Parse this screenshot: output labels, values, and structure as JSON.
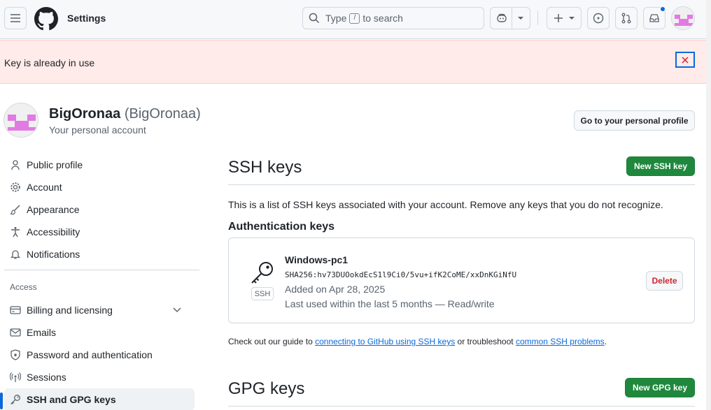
{
  "header": {
    "title": "Settings",
    "search": {
      "prefix": "Type",
      "key": "/",
      "suffix": "to search"
    }
  },
  "flash": {
    "message": "Key is already in use"
  },
  "profile": {
    "name": "BigOronaa",
    "handle": "(BigOronaa)",
    "subtitle": "Your personal account",
    "go_profile_label": "Go to your personal profile"
  },
  "sidebar": {
    "items": [
      {
        "label": "Public profile",
        "icon": "person-icon"
      },
      {
        "label": "Account",
        "icon": "gear-icon"
      },
      {
        "label": "Appearance",
        "icon": "paintbrush-icon"
      },
      {
        "label": "Accessibility",
        "icon": "accessibility-icon"
      },
      {
        "label": "Notifications",
        "icon": "bell-icon"
      }
    ],
    "access_heading": "Access",
    "access_items": [
      {
        "label": "Billing and licensing",
        "icon": "credit-card-icon"
      },
      {
        "label": "Emails",
        "icon": "mail-icon"
      },
      {
        "label": "Password and authentication",
        "icon": "shield-lock-icon"
      },
      {
        "label": "Sessions",
        "icon": "broadcast-icon"
      },
      {
        "label": "SSH and GPG keys",
        "icon": "key-icon",
        "active": true
      }
    ]
  },
  "ssh": {
    "title": "SSH keys",
    "new_label": "New SSH key",
    "description": "This is a list of SSH keys associated with your account. Remove any keys that you do not recognize.",
    "auth_heading": "Authentication keys",
    "key": {
      "name": "Windows-pc1",
      "fingerprint": "SHA256:hv73DUOokdEcS1l9Ci0/5vu+ifK2CoME/xxDnKGiNfU",
      "added": "Added on Apr 28, 2025",
      "last_used": "Last used within the last 5 months — Read/write",
      "type_label": "SSH",
      "delete_label": "Delete"
    },
    "guide": {
      "prefix": "Check out our guide to",
      "link1": "connecting to GitHub using SSH keys",
      "middle": "or troubleshoot",
      "link2": "common SSH problems",
      "suffix": "."
    }
  },
  "gpg": {
    "title": "GPG keys",
    "new_label": "New GPG key"
  },
  "colors": {
    "primary": "#1f883d",
    "accent": "#0969da",
    "danger": "#d1242f",
    "flash_bg": "#ffebe9"
  }
}
